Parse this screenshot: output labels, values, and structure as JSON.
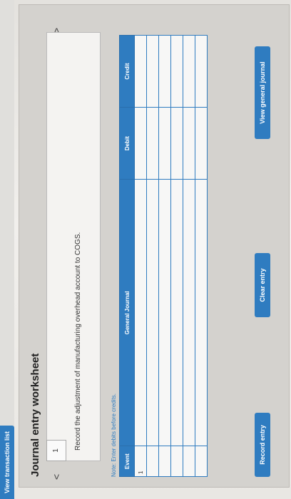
{
  "top": {
    "view_transaction_list": "View transaction list"
  },
  "panel": {
    "title": "Journal entry worksheet",
    "chev_left": "<",
    "chev_right": ">",
    "step_number": "1",
    "instruction": "Record the adjustment of manufacturing overhead account to COGS.",
    "note": "Note: Enter debits before credits."
  },
  "table": {
    "headers": [
      "Event",
      "General Journal",
      "Debit",
      "Credit"
    ],
    "rows": [
      [
        "1",
        "",
        "",
        ""
      ],
      [
        "",
        "",
        "",
        ""
      ],
      [
        "",
        "",
        "",
        ""
      ],
      [
        "",
        "",
        "",
        ""
      ],
      [
        "",
        "",
        "",
        ""
      ],
      [
        "",
        "",
        "",
        ""
      ]
    ]
  },
  "buttons": {
    "record_entry": "Record entry",
    "clear_entry": "Clear entry",
    "view_general_journal": "View general journal"
  },
  "colors": {
    "accent": "#2f7cc0",
    "panel_bg": "#d4d2ce",
    "paper": "#f4f3f1"
  }
}
